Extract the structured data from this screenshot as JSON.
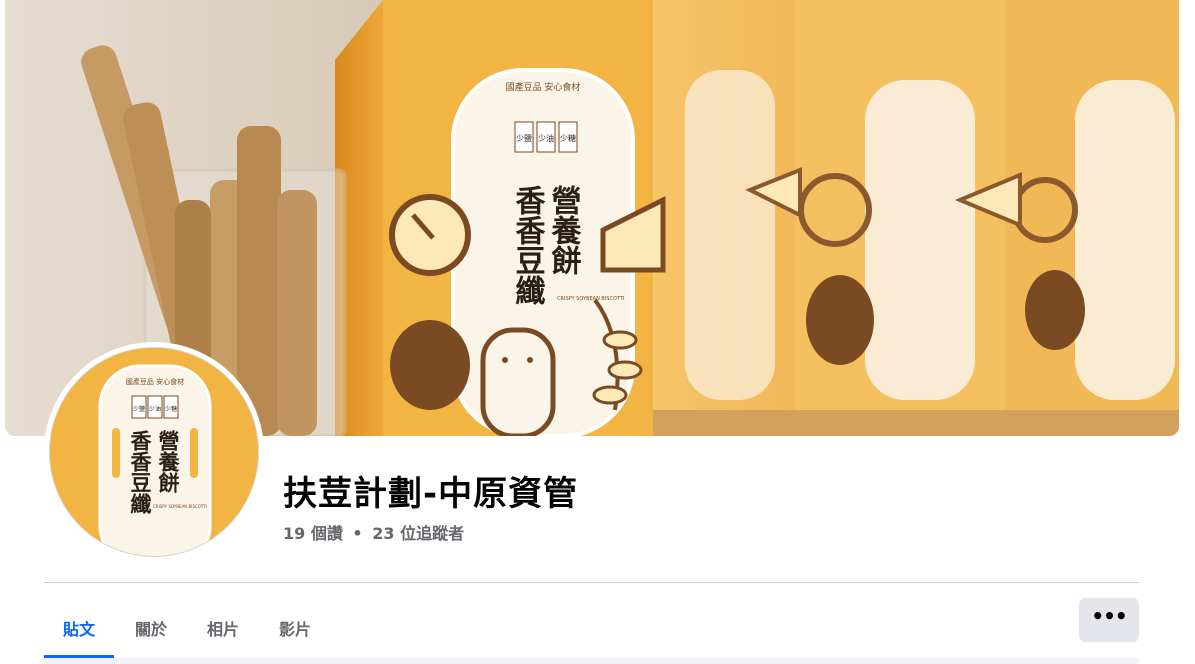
{
  "page": {
    "name": "扶荳計劃-中原資管",
    "likes": "19 個讚",
    "separator": "•",
    "followers": "23 位追蹤者"
  },
  "cover": {
    "box_text_main_right": "營養餅",
    "box_text_main_left": "香香豆纖",
    "box_badges": [
      "少鹽",
      "少油",
      "少糖"
    ],
    "box_subtitle": "CRISPY SOYBEAN BISCOTTI",
    "box_top_text": "國產豆品 安心食材"
  },
  "avatar": {
    "badges": [
      "少鹽",
      "少油",
      "少糖"
    ],
    "title_right": "營養餅",
    "title_left": "香香豆纖",
    "subtitle": "CRISPY SOYBEAN BISCOTTI",
    "top_text": "國產豆品 安心食材"
  },
  "tabs": [
    {
      "label": "貼文",
      "active": true
    },
    {
      "label": "關於",
      "active": false
    },
    {
      "label": "相片",
      "active": false
    },
    {
      "label": "影片",
      "active": false
    }
  ],
  "more_button": {
    "label": "•••",
    "icon": "more-horizontal-icon"
  },
  "colors": {
    "accent": "#0866ff",
    "box_yellow": "#f2b544",
    "text_primary": "#050505",
    "text_secondary": "#65676b"
  }
}
